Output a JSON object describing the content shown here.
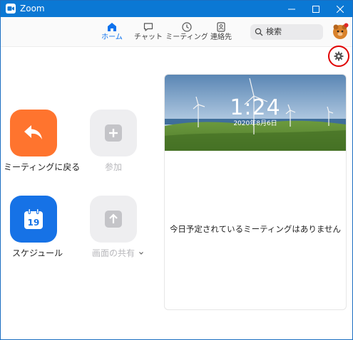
{
  "window": {
    "title": "Zoom"
  },
  "nav": {
    "tabs": [
      {
        "label": "ホーム",
        "icon": "home-icon",
        "active": true
      },
      {
        "label": "チャット",
        "icon": "chat-icon",
        "active": false
      },
      {
        "label": "ミーティング",
        "icon": "clock-icon",
        "active": false
      },
      {
        "label": "連絡先",
        "icon": "contacts-icon",
        "active": false
      }
    ]
  },
  "search": {
    "placeholder": "検索"
  },
  "actions": {
    "return_to_meeting": "ミーティングに戻る",
    "join": "参加",
    "schedule": "スケジュール",
    "schedule_day": "19",
    "share_screen": "画面の共有"
  },
  "panel": {
    "time": "1:24",
    "date": "2020年8月6日",
    "empty_message": "今日予定されているミーティングはありません"
  },
  "colors": {
    "titlebar": "#0b78d4",
    "accent": "#0e72ed",
    "orange": "#ff742e",
    "highlight": "#e00000"
  }
}
